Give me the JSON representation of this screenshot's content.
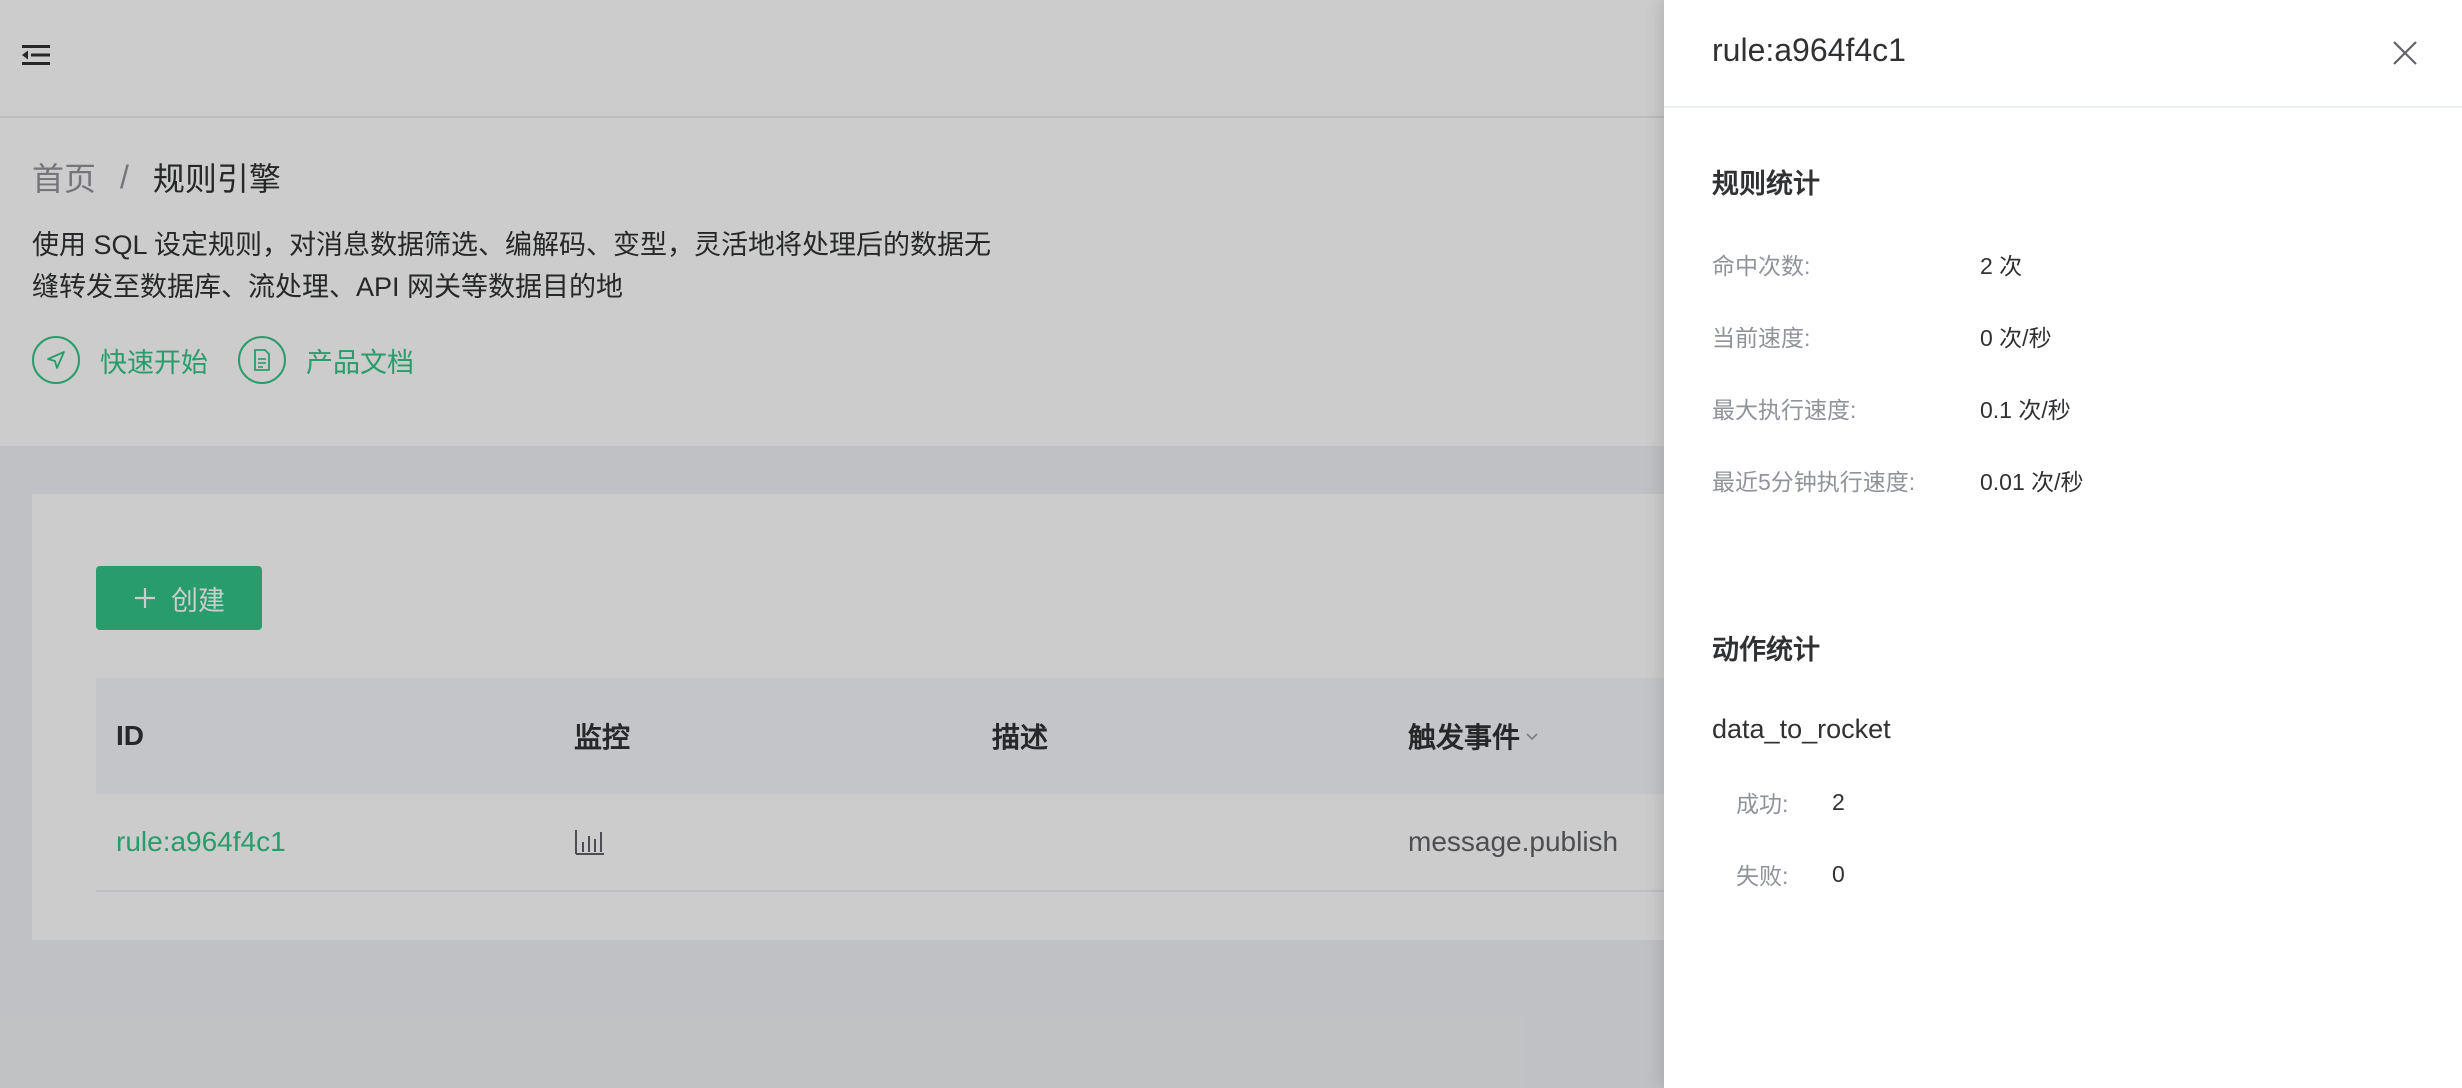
{
  "header": {
    "menu_toggle_icon": "menu-fold-icon"
  },
  "breadcrumb": {
    "home": "首页",
    "separator": "/",
    "current": "规则引擎"
  },
  "page": {
    "description_line1": "使用 SQL 设定规则，对消息数据筛选、编解码、变型，灵活地将处理后的数据无",
    "description_line2": "缝转发至数据库、流处理、API 网关等数据目的地",
    "links": {
      "quick_start": "快速开始",
      "docs": "产品文档"
    }
  },
  "toolbar": {
    "create_label": "创建"
  },
  "table": {
    "columns": {
      "id": "ID",
      "monitor": "监控",
      "description": "描述",
      "event": "触发事件"
    },
    "rows": [
      {
        "id": "rule:a964f4c1",
        "description": "",
        "event": "message.publish"
      }
    ]
  },
  "drawer": {
    "title": "rule:a964f4c1",
    "rule_stats": {
      "title": "规则统计",
      "matched_label": "命中次数:",
      "matched_value": "2 次",
      "speed_label": "当前速度:",
      "speed_value": "0 次/秒",
      "max_speed_label": "最大执行速度:",
      "max_speed_value": "0.1 次/秒",
      "last5m_label": "最近5分钟执行速度:",
      "last5m_value": "0.01 次/秒"
    },
    "action_stats": {
      "title": "动作统计",
      "actions": [
        {
          "name": "data_to_rocket",
          "success_label": "成功:",
          "success_value": "2",
          "failed_label": "失败:",
          "failed_value": "0"
        }
      ]
    }
  },
  "colors": {
    "accent": "#34c388",
    "mask": "rgba(0,0,0,0.2)"
  }
}
